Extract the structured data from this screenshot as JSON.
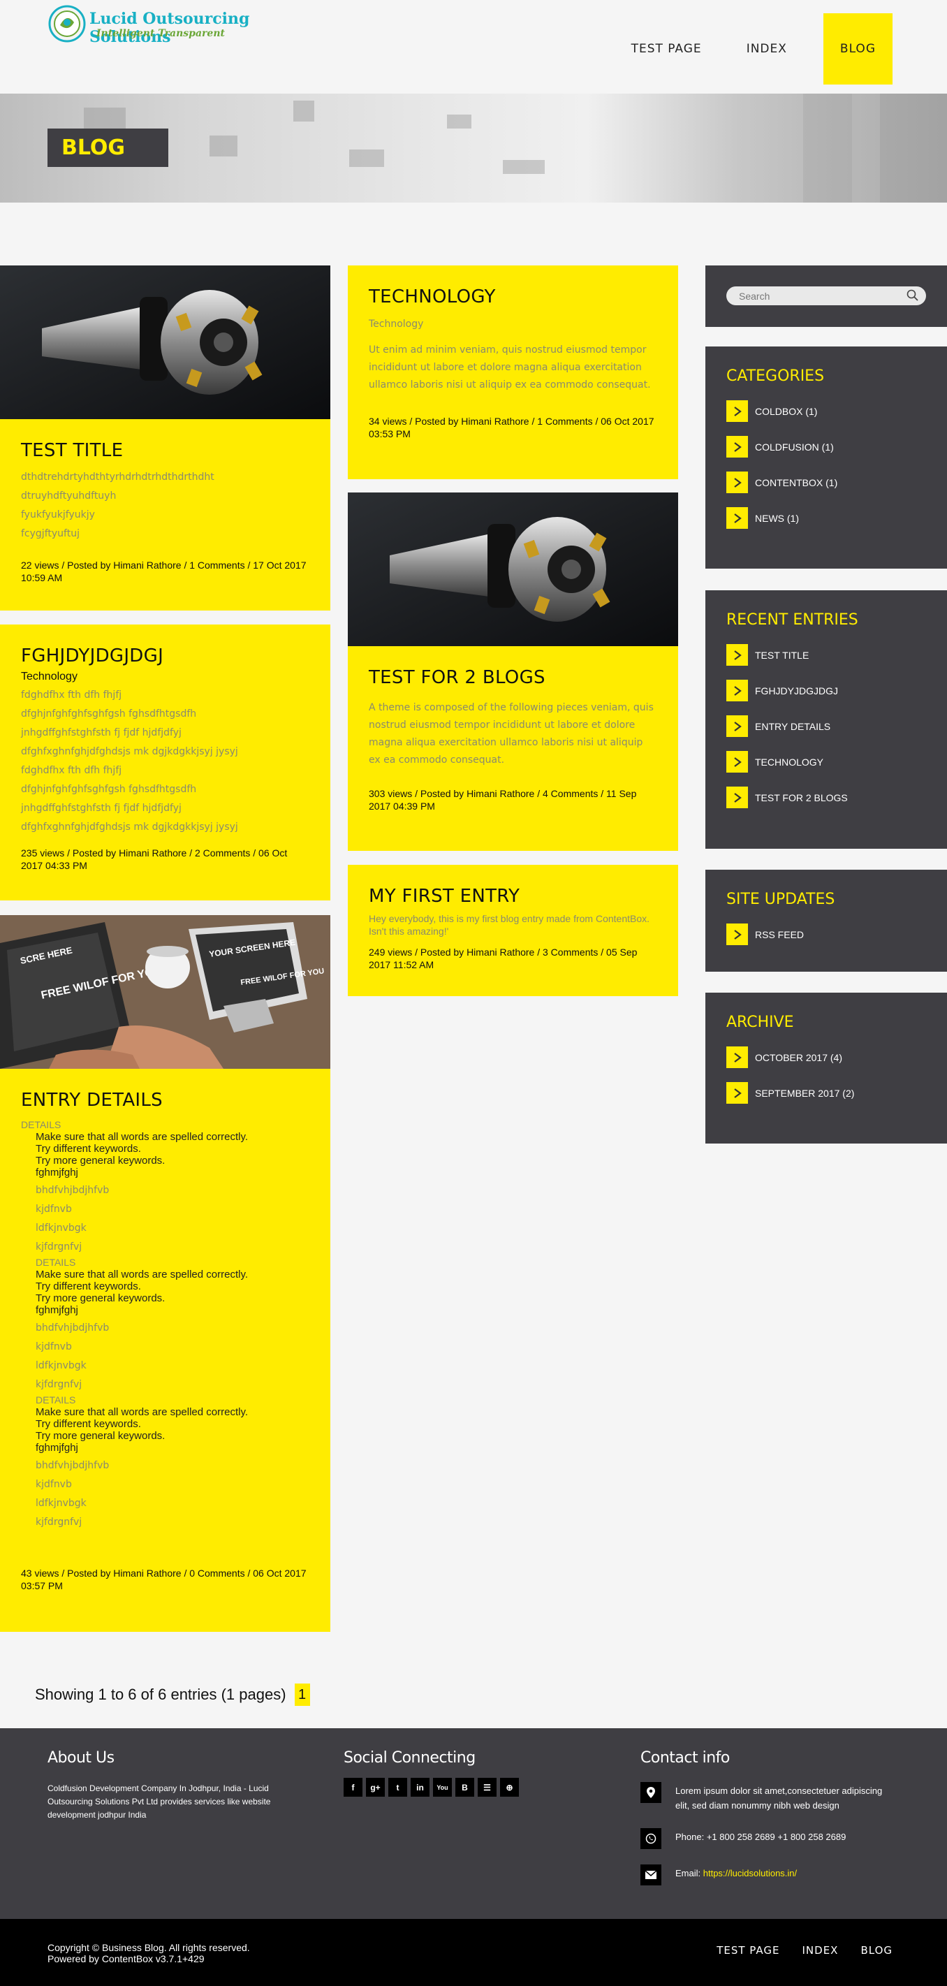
{
  "header": {
    "logo_title": "Lucid Outsourcing Solutions",
    "logo_tagline": "Intelligent Transparent",
    "nav": [
      "TEST PAGE",
      "INDEX",
      "BLOG"
    ]
  },
  "banner": {
    "title": "BLOG"
  },
  "posts": {
    "test_title": {
      "title": "TEST TITLE",
      "lines": [
        "dthdtrehdrtyhdthtyrhdrhdtrhdthdrthdht",
        "dtruyhdftyuhdftuyh",
        "fyukfyukjfyukjy",
        "fcygjftyuftuj"
      ],
      "meta": "22 views / Posted by Himani Rathore / 1 Comments / 17 Oct 2017 10:59 AM"
    },
    "fghj": {
      "title": "FGHJDYJDGJDGJ",
      "category": "Technology",
      "lines": [
        "fdghdfhx fth dfh fhjfj",
        "dfghjnfghfghfsghfgsh fghsdfhtgsdfh",
        "jnhgdffghfstghfsth fj fjdf hjdfjdfyj",
        "dfghfxghnfghjdfghdsjs mk dgjkdgkkjsyj  jysyj",
        "fdghdfhx fth dfh fhjfj",
        "dfghjnfghfghfsghfgsh fghsdfhtgsdfh",
        "jnhgdffghfstghfsth fj fjdf hjdfjdfyj",
        "dfghfxghnfghjdfghdsjs mk dgjkdgkkjsyj  jysyj"
      ],
      "meta": "235 views / Posted by Himani Rathore / 2 Comments / 06 Oct 2017 04:33 PM"
    },
    "entry_details": {
      "title": "ENTRY DETAILS",
      "blocks": [
        {
          "label": "DETAILS",
          "tips": [
            "Make sure that all words are spelled correctly.",
            "Try different keywords.",
            "Try more general keywords."
          ],
          "word": "fghmjfghj",
          "subs": [
            "bhdfvhjbdjhfvb",
            "kjdfnvb",
            "ldfkjnvbgk",
            "kjfdrgnfvj"
          ]
        },
        {
          "label": "DETAILS",
          "tips": [
            "Make sure that all words are spelled correctly.",
            "Try different keywords.",
            "Try more general keywords."
          ],
          "word": "fghmjfghj",
          "subs": [
            "bhdfvhjbdjhfvb",
            "kjdfnvb",
            "ldfkjnvbgk",
            "kjfdrgnfvj"
          ]
        },
        {
          "label": "DETAILS",
          "tips": [
            "Make sure that all words are spelled correctly.",
            "Try different keywords.",
            "Try more general keywords."
          ],
          "word": "fghmjfghj",
          "subs": [
            "bhdfvhjbdjhfvb",
            "kjdfnvb",
            "ldfkjnvbgk",
            "kjfdrgnfvj"
          ]
        }
      ],
      "meta": "43 views / Posted by Himani Rathore / 0 Comments / 06 Oct 2017 03:57 PM"
    },
    "technology": {
      "title": "TECHNOLOGY",
      "category": "Technology",
      "text": "Ut enim ad minim veniam, quis nostrud eiusmod tempor incididunt ut labore et dolore magna aliqua exercitation ullamco laboris nisi ut aliquip ex ea commodo consequat.",
      "meta": "34 views / Posted by Himani Rathore / 1 Comments / 06 Oct 2017 03:53 PM"
    },
    "two_blogs": {
      "title": "TEST FOR 2 BLOGS",
      "text": "A theme is composed of the following pieces veniam, quis nostrud eiusmod tempor incididunt ut labore et dolore magna aliqua exercitation ullamco laboris nisi ut aliquip ex ea commodo consequat.",
      "meta": "303 views / Posted by Himani Rathore / 4 Comments / 11 Sep 2017 04:39 PM"
    },
    "first_entry": {
      "title": "MY FIRST ENTRY",
      "text": "Hey everybody, this is my first blog entry made from ContentBox. Isn't this amazing!'",
      "meta": "249 views / Posted by Himani Rathore / 3 Comments / 05 Sep 2017 11:52 AM"
    }
  },
  "laptop_image_text": {
    "a": "SCRE HERE",
    "b": "FREE WILOF FOR YOU",
    "c": "YOUR SCREEN HERE",
    "d": "FREE WILOF FOR YOU"
  },
  "sidebar": {
    "search_placeholder": "Search",
    "categories": {
      "title": "CATEGORIES",
      "items": [
        "COLDBOX (1)",
        "COLDFUSION (1)",
        "CONTENTBOX (1)",
        "NEWS (1)"
      ]
    },
    "recent": {
      "title": "RECENT ENTRIES",
      "items": [
        "TEST TITLE",
        "FGHJDYJDGJDGJ",
        "ENTRY DETAILS",
        "TECHNOLOGY",
        "TEST FOR 2 BLOGS"
      ]
    },
    "updates": {
      "title": "SITE UPDATES",
      "items": [
        "RSS FEED"
      ]
    },
    "archive": {
      "title": "ARCHIVE",
      "items": [
        "OCTOBER 2017 (4)",
        "SEPTEMBER 2017 (2)"
      ]
    }
  },
  "pager": {
    "text": "Showing 1 to 6 of 6 entries (1 pages)",
    "page": "1"
  },
  "footer": {
    "about_title": "About Us",
    "about_text": "Coldfusion Development Company In Jodhpur, India - Lucid Outsourcing Solutions Pvt Ltd provides services like website development jodhpur India",
    "social_title": "Social Connecting",
    "social_icons": [
      "facebook-icon",
      "google-plus-icon",
      "tumblr-icon",
      "linkedin-icon",
      "youtube-icon",
      "blogger-icon",
      "rss-icon",
      "dribbble-icon"
    ],
    "social_glyphs": [
      "f",
      "g+",
      "t",
      "in",
      "You",
      "B",
      "☰",
      "⊕"
    ],
    "contact_title": "Contact info",
    "address": "Lorem ipsum dolor sit amet,consectetuer adipiscing elit, sed diam nonummy nibh web design",
    "phone": "Phone: +1 800 258 2689 +1 800 258 2689",
    "email_label": "Email: ",
    "email": "https://lucidsolutions.in/"
  },
  "copyright": {
    "line1": "Copyright © Business Blog. All rights reserved.",
    "line2": "Powered by ContentBox v3.7.1+429",
    "nav": [
      "TEST PAGE",
      "INDEX",
      "BLOG"
    ]
  },
  "colors": {
    "accent": "#ffec00",
    "dark": "#3f3e43",
    "muted": "#8a8a6e",
    "link": "#ffec00"
  }
}
